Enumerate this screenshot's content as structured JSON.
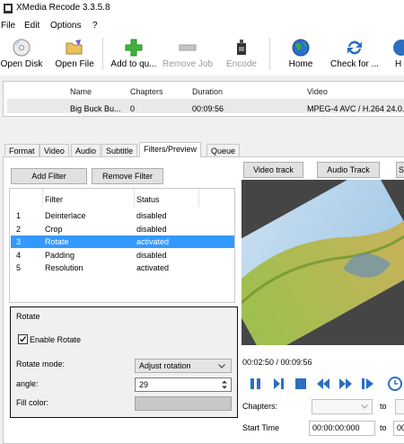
{
  "window": {
    "title": "XMedia Recode 3.3.5.8"
  },
  "menu": {
    "items": [
      "File",
      "Edit",
      "Options",
      "?"
    ]
  },
  "toolbar": {
    "open_disk": "Open Disk",
    "open_file": "Open File",
    "add_to_queue": "Add to qu...",
    "remove_job": "Remove Job",
    "encode": "Encode",
    "home": "Home",
    "check_for": "Check for ...",
    "help": "H"
  },
  "file_list": {
    "headers": [
      "Name",
      "Chapters",
      "Duration",
      "Video"
    ],
    "row": {
      "name": "Big Buck Bu...",
      "chapters": "0",
      "duration": "00:09:56",
      "video": "MPEG-4 AVC / H.264 24.0..."
    }
  },
  "tabs": [
    "Format",
    "Video",
    "Audio",
    "Subtitle",
    "Filters/Preview",
    "Queue"
  ],
  "active_tab": "Filters/Preview",
  "filters_panel": {
    "add_filter": "Add Filter",
    "remove_filter": "Remove Filter",
    "headers": [
      "Filter",
      "Status"
    ],
    "rows": [
      {
        "num": "1",
        "filter": "Deinterlace",
        "status": "disabled"
      },
      {
        "num": "2",
        "filter": "Crop",
        "status": "disabled"
      },
      {
        "num": "3",
        "filter": "Rotate",
        "status": "activated"
      },
      {
        "num": "4",
        "filter": "Padding",
        "status": "disabled"
      },
      {
        "num": "5",
        "filter": "Resolution",
        "status": "activated"
      }
    ],
    "selected_row": "3"
  },
  "rotate_group": {
    "title": "Rotate",
    "enable_label": "Enable Rotate",
    "enable_checked": true,
    "mode_label": "Rotate mode:",
    "mode_value": "Adjust rotation",
    "angle_label": "angle:",
    "angle_value": "29",
    "fill_label": "Fill color:"
  },
  "preview_panel": {
    "video_track": "Video track",
    "audio_track": "Audio Track",
    "s_button": "S",
    "time": "00:02:50 / 00:09:56",
    "chapters_label": "Chapters:",
    "to": "to",
    "start_time_label": "Start Time",
    "start_time_value": "00:00:00:000",
    "end_prefix": "00"
  },
  "colors": {
    "selection": "#3399ff",
    "play_blue": "#2b6fc4",
    "toolbar_green": "#3db33d"
  }
}
